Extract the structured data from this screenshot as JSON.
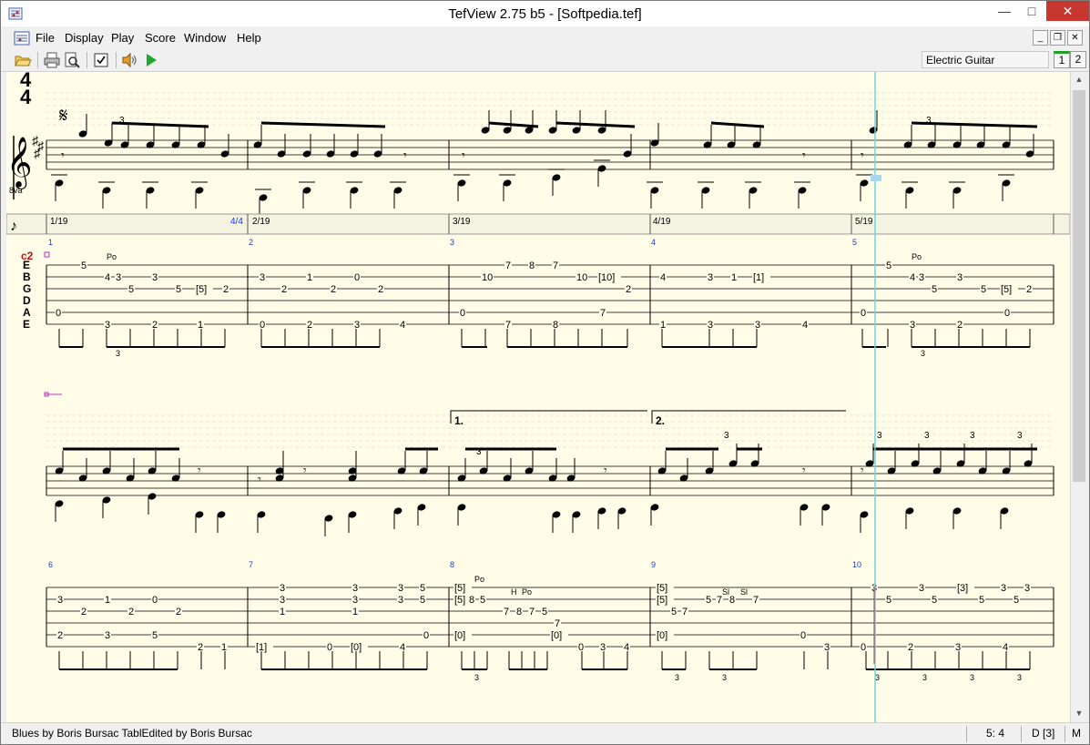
{
  "window": {
    "title": "TefView 2.75 b5  - [Softpedia.tef]"
  },
  "menu": {
    "items": [
      "File",
      "Display",
      "Play",
      "Score",
      "Window",
      "Help"
    ]
  },
  "toolbar": {
    "instrument": "Electric Guitar",
    "tracks": [
      "1",
      "2"
    ]
  },
  "time_signature": {
    "top": "4",
    "bottom": "4"
  },
  "clef_octave": "8va",
  "timeline": {
    "labels": [
      "1/19",
      "4/4",
      "2/19",
      "3/19",
      "4/19",
      "5/19"
    ]
  },
  "system1": {
    "measure_numbers": [
      "1",
      "2",
      "3",
      "4",
      "5"
    ],
    "string_labels": [
      "E",
      "B",
      "G",
      "D",
      "A",
      "E"
    ],
    "capo": "c2",
    "technique": [
      "Po",
      "Po"
    ],
    "triplet": "3"
  },
  "system2": {
    "measure_numbers": [
      "6",
      "7",
      "8",
      "9",
      "10"
    ],
    "endings": [
      "1.",
      "2."
    ],
    "techniques": [
      "Po",
      "H",
      "Po",
      "Sl",
      "Sl"
    ]
  },
  "statusbar": {
    "song": "Blues  by Boris Bursac  TablEdited by Boris Bursac",
    "position": "5: 4",
    "key": "D [3]",
    "mode": "M"
  }
}
